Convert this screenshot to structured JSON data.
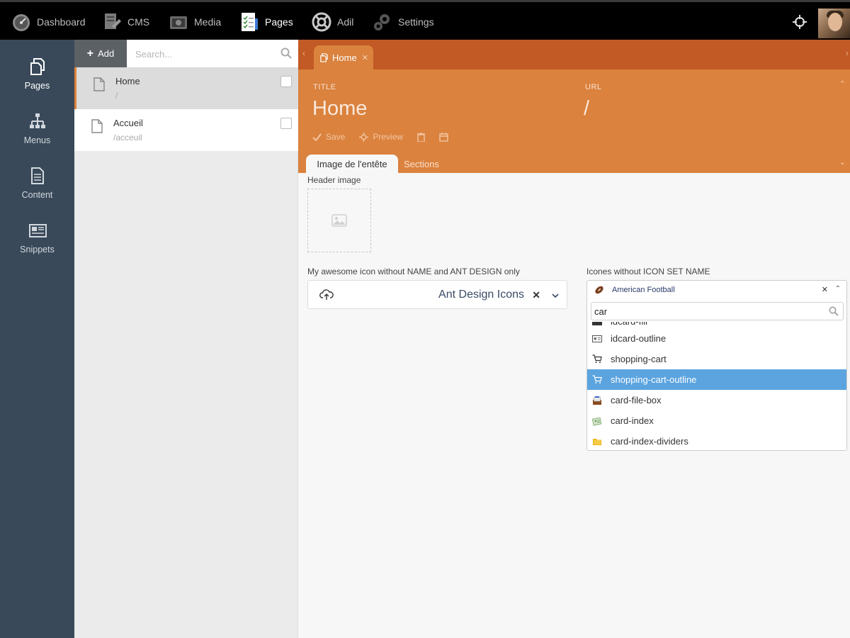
{
  "topnav": {
    "items": [
      {
        "label": "Dashboard",
        "icon": "speedometer-icon"
      },
      {
        "label": "CMS",
        "icon": "cms-icon"
      },
      {
        "label": "Media",
        "icon": "media-icon"
      },
      {
        "label": "Pages",
        "icon": "pages-icon"
      },
      {
        "label": "Adil",
        "icon": "lifebuoy-icon"
      },
      {
        "label": "Settings",
        "icon": "gears-icon"
      }
    ],
    "active": "Pages"
  },
  "sidebar": {
    "items": [
      {
        "label": "Pages",
        "icon": "copy-icon"
      },
      {
        "label": "Menus",
        "icon": "sitemap-icon"
      },
      {
        "label": "Content",
        "icon": "document-icon"
      },
      {
        "label": "Snippets",
        "icon": "newspaper-icon"
      }
    ]
  },
  "pagelist": {
    "add_label": "Add",
    "search_placeholder": "Search...",
    "rows": [
      {
        "title": "Home",
        "url": "/"
      },
      {
        "title": "Accueil",
        "url": "/acceuil"
      }
    ]
  },
  "editor": {
    "tab_label": "Home",
    "title_label": "TITLE",
    "title_value": "Home",
    "url_label": "URL",
    "url_value": "/",
    "save_label": "Save",
    "preview_label": "Preview",
    "subtabs": [
      "Image de l'entête",
      "Sections"
    ]
  },
  "form": {
    "header_image_label": "Header image",
    "ant_label": "My awesome icon without NAME and ANT DESIGN only",
    "ant_value": "Ant Design Icons",
    "icons_label": "Icones without ICON SET NAME",
    "icons_value": "American Football",
    "icons_search": "car",
    "options": [
      "idcard-fill",
      "idcard-outline",
      "shopping-cart",
      "shopping-cart-outline",
      "card-file-box",
      "card-index",
      "card-index-dividers"
    ],
    "highlighted_option": "shopping-cart-outline"
  },
  "colors": {
    "accent_orange": "#da823e",
    "tabstrip_orange": "#c25a25",
    "sidebar_navy": "#394959",
    "highlight_blue": "#5ba4e0"
  }
}
